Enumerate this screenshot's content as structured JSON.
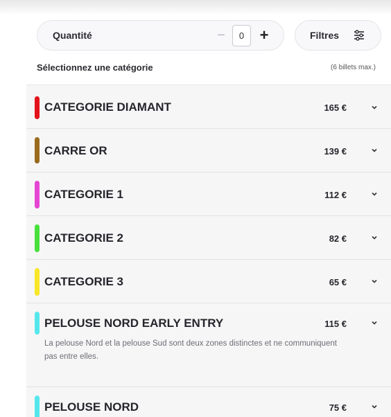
{
  "quantity": {
    "label": "Quantité",
    "minus": "−",
    "value": "0",
    "plus": "+"
  },
  "filters": {
    "label": "Filtres"
  },
  "category_section": {
    "title": "Sélectionnez une catégorie",
    "max_note": "(6 billets max.)"
  },
  "categories": [
    {
      "name": "CATEGORIE DIAMANT",
      "price": "165 €",
      "color": "#e3131b"
    },
    {
      "name": "CARRE OR",
      "price": "139 €",
      "color": "#9a6b1d"
    },
    {
      "name": "CATEGORIE 1",
      "price": "112 €",
      "color": "#e546d3"
    },
    {
      "name": "CATEGORIE 2",
      "price": "82 €",
      "color": "#49e03c"
    },
    {
      "name": "CATEGORIE 3",
      "price": "65 €",
      "color": "#f7e726"
    },
    {
      "name": "PELOUSE NORD EARLY ENTRY",
      "price": "115 €",
      "color": "#56e7ec",
      "description": "La pelouse Nord et la pelouse Sud sont deux zones distinctes et ne communiquent pas entre elles."
    },
    {
      "name": "PELOUSE NORD",
      "price": "75 €",
      "color": "#56e7ec"
    }
  ]
}
